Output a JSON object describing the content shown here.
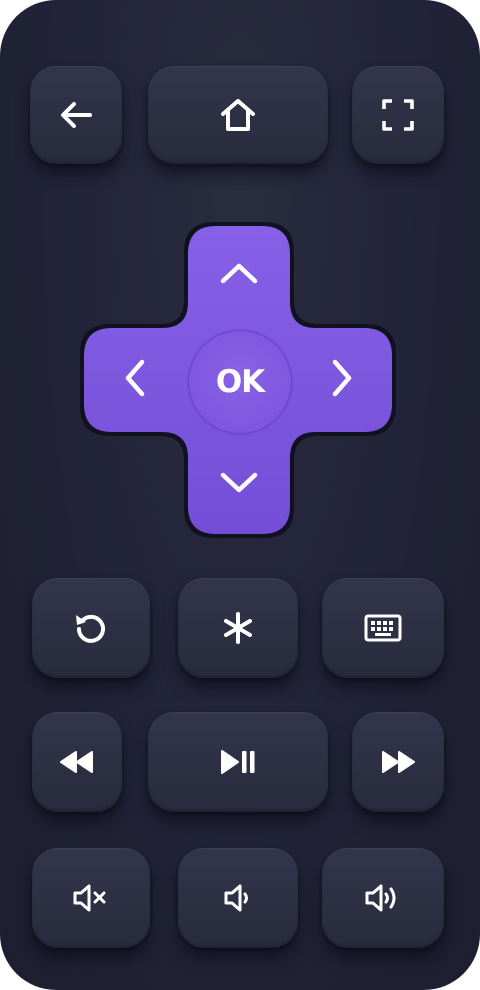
{
  "remote": {
    "body_color": "#23243a",
    "button_color": "#2e3045",
    "dpad_color": "#7c55df",
    "icon_color": "#ffffff"
  },
  "top_row": {
    "back": {
      "icon": "arrow-left-icon"
    },
    "home": {
      "icon": "home-icon"
    },
    "fullscreen": {
      "icon": "fullscreen-icon"
    }
  },
  "dpad": {
    "ok_label": "OK",
    "up": {
      "icon": "chevron-up-icon"
    },
    "down": {
      "icon": "chevron-down-icon"
    },
    "left": {
      "icon": "chevron-left-icon"
    },
    "right": {
      "icon": "chevron-right-icon"
    }
  },
  "middle_row": {
    "replay": {
      "icon": "replay-icon"
    },
    "options": {
      "icon": "asterisk-icon"
    },
    "keyboard": {
      "icon": "keyboard-icon"
    }
  },
  "media_row": {
    "rewind": {
      "icon": "rewind-icon"
    },
    "play_pause": {
      "icon": "play-pause-icon"
    },
    "fast_forward": {
      "icon": "fast-forward-icon"
    }
  },
  "volume_row": {
    "mute": {
      "icon": "volume-mute-icon"
    },
    "volume_down": {
      "icon": "volume-down-icon"
    },
    "volume_up": {
      "icon": "volume-up-icon"
    }
  }
}
